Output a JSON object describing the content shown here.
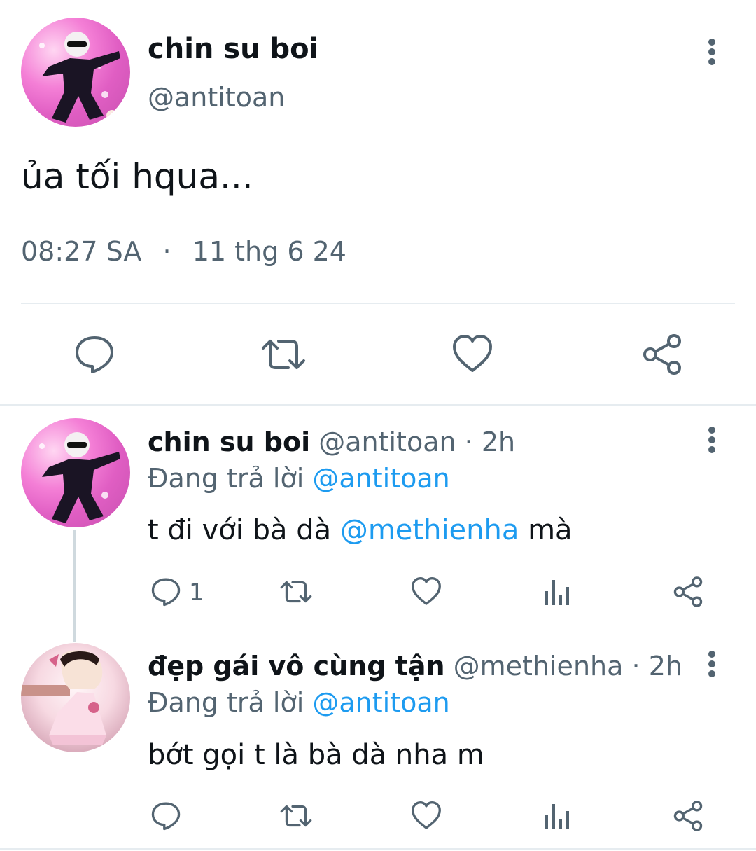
{
  "main_tweet": {
    "display_name": "chin su boi",
    "handle": "@antitoan",
    "text": "ủa tối hqua...",
    "time": "08:27 SA",
    "separator": "·",
    "date": "11 thg 6 24"
  },
  "replies": [
    {
      "display_name": "chin su boi",
      "handle": "@antitoan",
      "dot": "·",
      "age": "2h",
      "replying_label": "Đang trả lời",
      "replying_to": "@antitoan",
      "text_before": "t đi với bà dà ",
      "mention": "@methienha",
      "text_after": " mà",
      "reply_count": "1"
    },
    {
      "display_name": "đẹp gái vô cùng tận",
      "handle": "@methienha",
      "dot": "·",
      "age": "2h",
      "replying_label": "Đang trả lời",
      "replying_to": "@antitoan",
      "text": "bớt gọi t là bà dà nha m",
      "reply_count": ""
    }
  ],
  "colors": {
    "text": "#0f1419",
    "muted": "#536471",
    "link": "#1d9bf0",
    "divider": "#e6ecf0"
  },
  "icons": [
    "more-vert-icon",
    "reply-icon",
    "retweet-icon",
    "like-icon",
    "views-icon",
    "share-icon"
  ]
}
